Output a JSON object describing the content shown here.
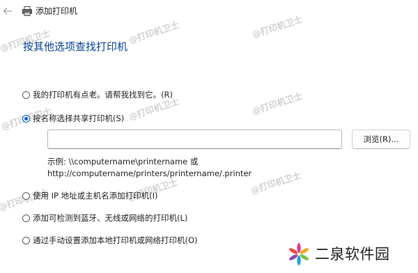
{
  "window": {
    "title": "添加打印机"
  },
  "heading": "按其他选项查找打印机",
  "options": [
    {
      "label": "我的打印机有点老。请帮我找到它。(R)",
      "checked": false
    },
    {
      "label": "按名称选择共享打印机(S)",
      "checked": true
    },
    {
      "label": "使用 IP 地址或主机名添加打印机(I)",
      "checked": false
    },
    {
      "label": "添加可检测到蓝牙、无线或网络的打印机(L)",
      "checked": false
    },
    {
      "label": "通过手动设置添加本地打印机或网络打印机(O)",
      "checked": false
    }
  ],
  "shared_printer": {
    "input_value": "",
    "browse_label": "浏览(R)...",
    "example_line1": "示例: \\\\computername\\printername 或",
    "example_line2": "http://computername/printers/printername/.printer"
  },
  "watermark": "@打印机卫士",
  "logo": {
    "text": "二泉软件园"
  },
  "colors": {
    "heading": "#003e92",
    "radio_selected": "#0a5fcf"
  },
  "icons": {
    "back": "back-arrow-icon",
    "printer": "printer-icon",
    "logo": "pinwheel-logo-icon"
  }
}
